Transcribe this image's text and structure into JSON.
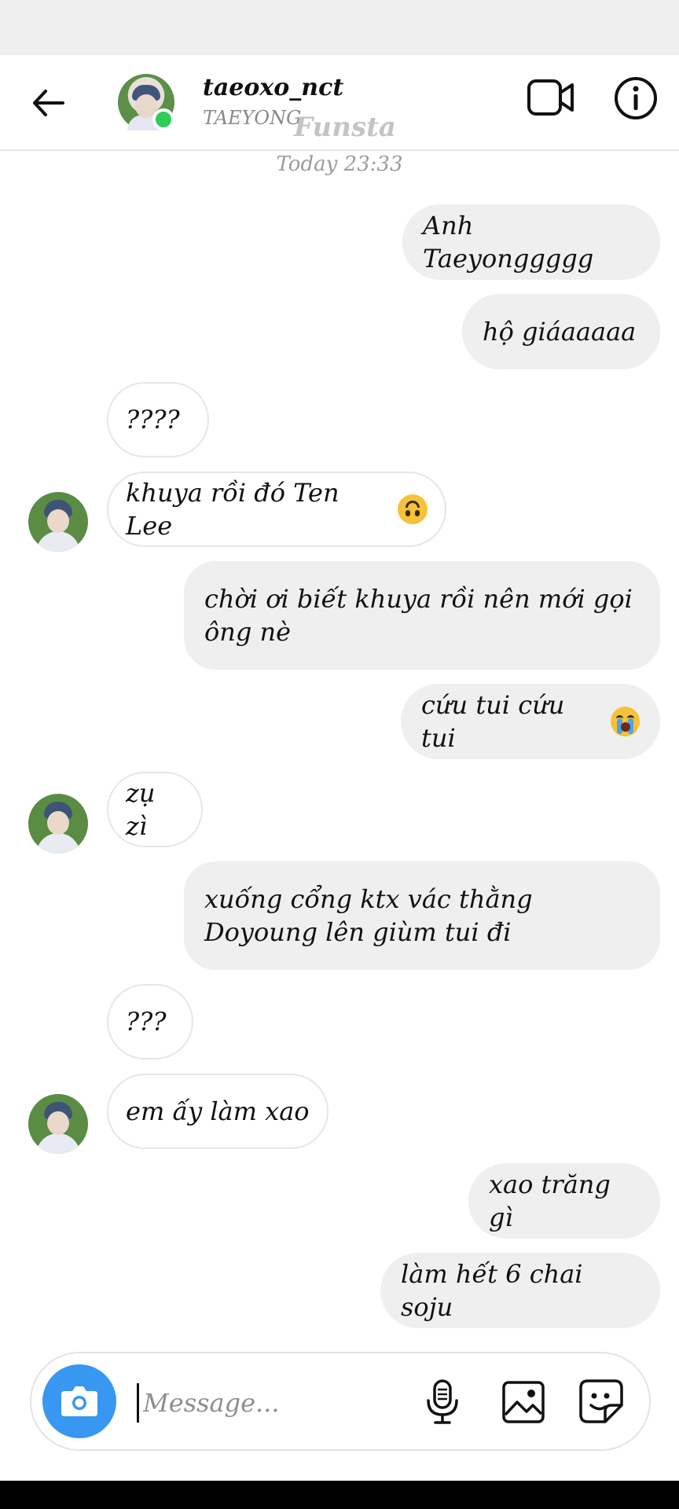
{
  "header": {
    "username": "taeoxo_nct",
    "display_name": "TAEYONG",
    "watermark": "Funsta",
    "online_color": "#2ecc5b"
  },
  "timestamp": "Today 23:33",
  "messages": [
    {
      "side": "out",
      "text": "Anh Taeyonggggg"
    },
    {
      "side": "out",
      "text": "hộ giáaaaaa"
    },
    {
      "side": "in",
      "text": "????"
    },
    {
      "side": "in",
      "text": "khuya rồi đó Ten Lee",
      "emoji": "upside-down-face-emoji"
    },
    {
      "side": "out",
      "text": "chời ơi biết khuya rồi nên mới gọi ông nè"
    },
    {
      "side": "out",
      "text": "cứu tui cứu tui",
      "emoji": "crying-face-emoji"
    },
    {
      "side": "in",
      "text": "zụ zì"
    },
    {
      "side": "out",
      "text": "xuống cổng ktx vác thằng Doyoung lên giùm tui đi"
    },
    {
      "side": "in",
      "text": "???"
    },
    {
      "side": "in",
      "text": "em ấy làm xao"
    },
    {
      "side": "out",
      "text": "xao trăng gì"
    },
    {
      "side": "out",
      "text": "làm hết 6 chai soju"
    }
  ],
  "composer": {
    "placeholder": "Message...",
    "camera_color": "#3897f0",
    "icons": [
      "camera-icon",
      "microphone-icon",
      "gallery-icon",
      "sticker-icon"
    ]
  },
  "colors": {
    "outgoing_bubble": "#efefef",
    "incoming_border": "#e6e6e6",
    "muted_text": "#9b9b9b"
  }
}
